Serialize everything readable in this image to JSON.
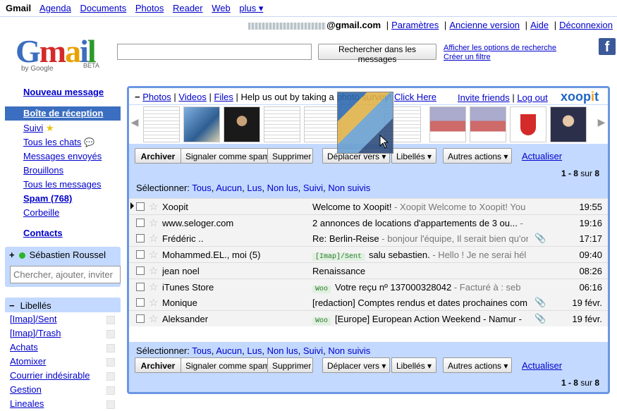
{
  "topnav": [
    "Gmail",
    "Agenda",
    "Documents",
    "Photos",
    "Reader",
    "Web",
    "plus ▾"
  ],
  "account": {
    "email_suffix": "@gmail.com",
    "links": [
      "Paramètres",
      "Ancienne version",
      "Aide",
      "Déconnexion"
    ]
  },
  "logo": {
    "text": "Gmail",
    "by": "by Google",
    "beta": "BETA"
  },
  "search": {
    "button": "Rechercher dans les messages",
    "options": "Afficher les options de recherche",
    "filter": "Créer un filtre"
  },
  "nav": {
    "compose": "Nouveau message",
    "inbox": "Boîte de réception",
    "items": [
      "Suivi",
      "Tous les chats",
      "Messages envoyés",
      "Brouillons",
      "Tous les messages",
      "Spam (768)",
      "Corbeille"
    ],
    "contacts": "Contacts"
  },
  "chat": {
    "name": "Sébastien Roussel",
    "placeholder": "Chercher, ajouter, inviter"
  },
  "labels": {
    "title": "Libellés",
    "items": [
      "[Imap]/Sent",
      "[Imap]/Trash",
      "Achats",
      "Atomixer",
      "Courrier indésirable",
      "Gestion",
      "Lineales"
    ]
  },
  "xoopit": {
    "links": [
      "Photos",
      "Videos",
      "Files"
    ],
    "survey_text": "Help us out by taking a photo survey!",
    "survey_link": "Click Here",
    "invite": "Invite friends",
    "logout": "Log out",
    "logo": "xoopit"
  },
  "toolbar": {
    "archive": "Archiver",
    "spam": "Signaler comme spam",
    "delete": "Supprimer",
    "move": "Déplacer vers ▾",
    "labels": "Libellés ▾",
    "more": "Autres actions ▾",
    "refresh": "Actualiser",
    "count": "1 - 8",
    "count_of": "sur",
    "count_total": "8"
  },
  "select": {
    "label": "Sélectionner:",
    "options": [
      "Tous",
      "Aucun",
      "Lus",
      "Non lus",
      "Suivi",
      "Non suivis"
    ]
  },
  "messages": [
    {
      "from": "Xoopit",
      "tag": "",
      "subject": "Welcome to Xoopit!",
      "snippet": " - Xoopit Welcome to Xoopit! You",
      "attach": false,
      "date": "19:55"
    },
    {
      "from": "www.seloger.com",
      "tag": "",
      "subject": "2 annonces de locations d'appartements de 3 ou...",
      "snippet": " -",
      "attach": false,
      "date": "19:16"
    },
    {
      "from": "Frédéric ..",
      "tag": "",
      "subject": "Re: Berlin-Reise",
      "snippet": " - bonjour l'équipe, Il serait bien qu'on",
      "attach": true,
      "date": "17:17"
    },
    {
      "from": "Mohammed.EL., moi (5)",
      "tag": "[Imap]/Sent",
      "subject": "salu sebastien.",
      "snippet": " - Hello ! Je ne serai hél",
      "attach": false,
      "date": "09:40"
    },
    {
      "from": "jean noel",
      "tag": "",
      "subject": "Renaissance",
      "snippet": "",
      "attach": false,
      "date": "08:26"
    },
    {
      "from": "iTunes Store",
      "tag": "Woo",
      "subject": "Votre reçu nº 137000328042",
      "snippet": " - Facturé à : seb",
      "attach": false,
      "date": "06:16"
    },
    {
      "from": "Monique",
      "tag": "",
      "subject": "[redaction] Comptes rendus et dates prochaines com",
      "snippet": "",
      "attach": true,
      "date": "19 févr."
    },
    {
      "from": "Aleksander",
      "tag": "Woo",
      "subject": "[Europe] European Action Weekend - Namur -",
      "snippet": "",
      "attach": true,
      "date": "19 févr."
    }
  ]
}
